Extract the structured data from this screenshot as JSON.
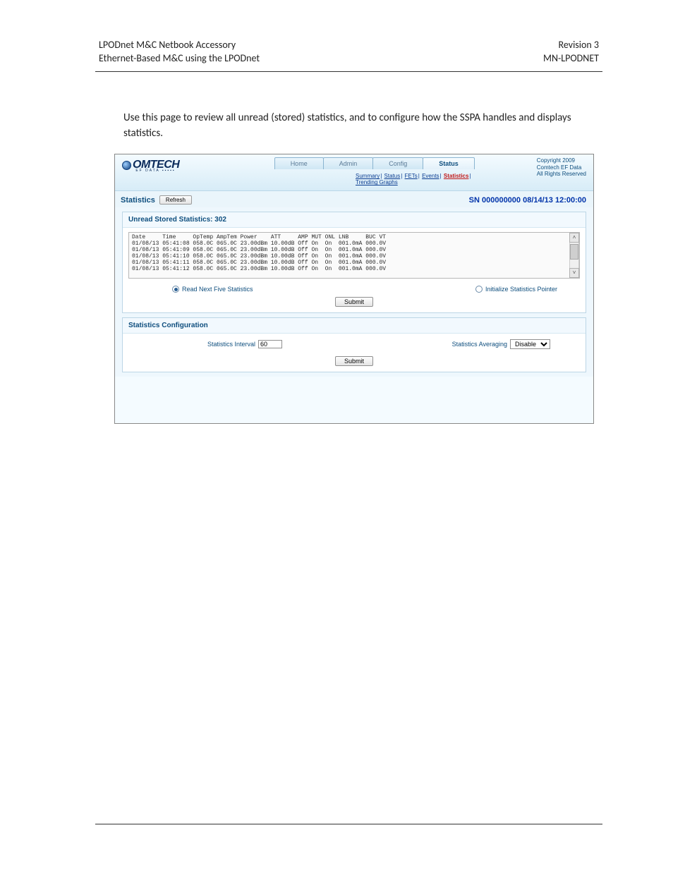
{
  "doc_header": {
    "left_line1": "LPODnet M&C Netbook Accessory",
    "left_line2": "Ethernet-Based M&C using the LPODnet",
    "right_line1": "Revision 3",
    "right_line2": "MN-LPODNET"
  },
  "body_paragraph": "Use this page to review all unread (stored) statistics, and to configure how the SSPA handles and displays statistics.",
  "ui": {
    "logo_text": "OMTECH",
    "logo_sub": "EF DATA ▪▪▪▪▪",
    "tabs": [
      "Home",
      "Admin",
      "Config",
      "Status"
    ],
    "active_tab": "Status",
    "subnav": {
      "items": [
        "Summary",
        "Status",
        "FETs",
        "Events",
        "Statistics"
      ],
      "selected": "Statistics",
      "line2": "Trending Graphs"
    },
    "copyright": {
      "l1": "Copyright 2009",
      "l2": "Comtech EF Data",
      "l3": "All Rights Reserved"
    },
    "stats_label": "Statistics",
    "refresh_label": "Refresh",
    "sn": "SN 000000000 08/14/13 12:00:00",
    "panel1_title": "Unread Stored Statistics: 302",
    "columns_header": "Date     Time     OpTemp AmpTem Power    ATT     AMP MUT ONL LNB     BUC VT",
    "rows": [
      "01/08/13 05:41:08 058.0C 065.0C 23.00dBm 10.00dB Off On  On  001.0mA 000.0V",
      "01/08/13 05:41:09 058.0C 065.0C 23.00dBm 10.00dB Off On  On  001.0mA 000.0V",
      "01/08/13 05:41:10 058.0C 065.0C 23.00dBm 10.00dB Off On  On  001.0mA 000.0V",
      "01/08/13 05:41:11 058.0C 065.0C 23.00dBm 10.00dB Off On  On  001.0mA 000.0V",
      "01/08/13 05:41:12 058.0C 065.0C 23.00dBm 10.00dB Off On  On  001.0mA 000.0V"
    ],
    "radio1": "Read Next Five Statistics",
    "radio2": "Initialize Statistics Pointer",
    "submit": "Submit",
    "panel2_title": "Statistics Configuration",
    "interval_label": "Statistics Interval",
    "interval_value": "60",
    "averaging_label": "Statistics Averaging",
    "averaging_value": "Disable"
  }
}
